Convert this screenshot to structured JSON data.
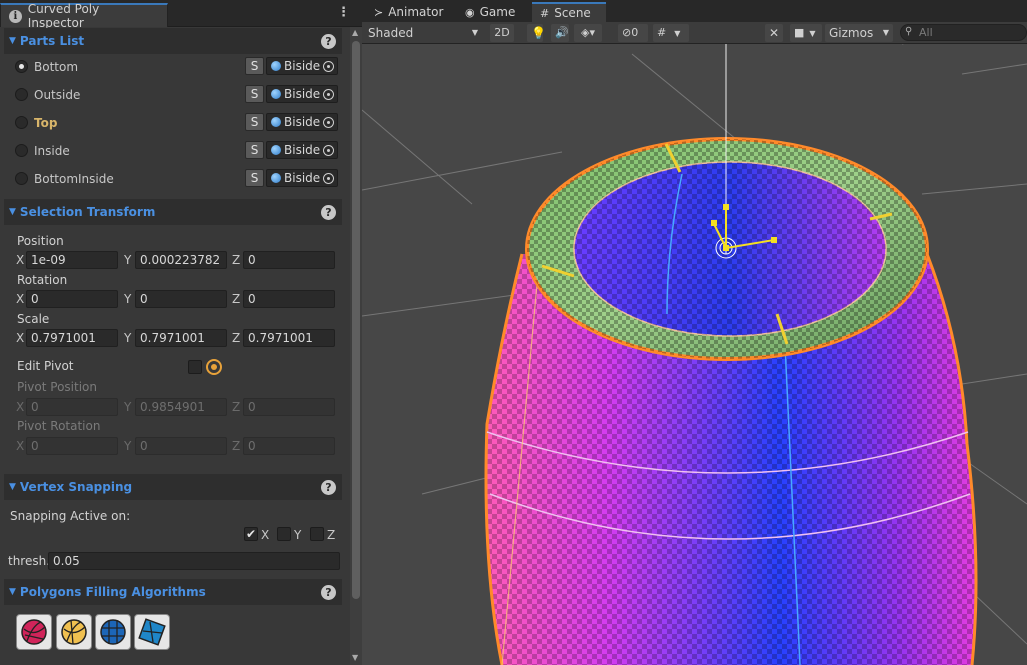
{
  "inspector": {
    "tab_title": "Curved Poly Inspector",
    "parts_list": {
      "title": "Parts List",
      "items": [
        {
          "label": "Bottom",
          "selected": true,
          "highlight": false,
          "s": "S",
          "mode": "Biside"
        },
        {
          "label": "Outside",
          "selected": false,
          "highlight": false,
          "s": "S",
          "mode": "Biside"
        },
        {
          "label": "Top",
          "selected": false,
          "highlight": true,
          "s": "S",
          "mode": "Biside"
        },
        {
          "label": "Inside",
          "selected": false,
          "highlight": false,
          "s": "S",
          "mode": "Biside"
        },
        {
          "label": "BottomInside",
          "selected": false,
          "highlight": false,
          "s": "S",
          "mode": "Biside"
        }
      ]
    },
    "selection_transform": {
      "title": "Selection Transform",
      "position_label": "Position",
      "position": {
        "x": "1e-09",
        "y": "0.000223782",
        "z": "0"
      },
      "rotation_label": "Rotation",
      "rotation": {
        "x": "0",
        "y": "0",
        "z": "0"
      },
      "scale_label": "Scale",
      "scale": {
        "x": "0.7971001",
        "y": "0.7971001",
        "z": "0.7971001"
      },
      "edit_pivot_label": "Edit Pivot",
      "pivot_position_label": "Pivot Position",
      "pivot_position": {
        "x": "0",
        "y": "0.9854901",
        "z": "0"
      },
      "pivot_rotation_label": "Pivot Rotation",
      "pivot_rotation": {
        "x": "0",
        "y": "0",
        "z": "0"
      }
    },
    "axes": {
      "x": "X",
      "y": "Y",
      "z": "Z"
    },
    "vertex_snapping": {
      "title": "Vertex Snapping",
      "active_label": "Snapping Active on:",
      "x_label": "X",
      "y_label": "Y",
      "z_label": "Z",
      "x_checked": true,
      "y_checked": false,
      "z_checked": false,
      "thresh_label": "thresh.",
      "thresh_value": "0.05"
    },
    "polygons": {
      "title": "Polygons Filling Algorithms",
      "icons": [
        "algo-red-icon",
        "algo-yellow-icon",
        "algo-blue-icon",
        "algo-cyan-icon"
      ]
    }
  },
  "scene": {
    "tabs": [
      {
        "label": "Animator",
        "icon": "animator-icon"
      },
      {
        "label": "Game",
        "icon": "game-icon"
      },
      {
        "label": "Scene",
        "icon": "scene-icon"
      }
    ],
    "shading_mode": "Shaded",
    "btn_2d": "2D",
    "hidden_count": "0",
    "gizmos_label": "Gizmos",
    "search_placeholder": "All"
  }
}
